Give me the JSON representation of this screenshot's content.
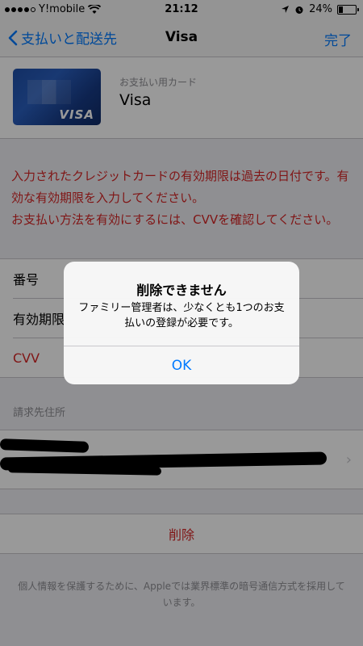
{
  "status_bar": {
    "carrier": "Y!mobile",
    "time": "21:12",
    "battery_percent": "24%",
    "battery_level": 0.24,
    "signal_bars_filled": 4,
    "icons": [
      "wifi-icon",
      "location-icon",
      "alarm-icon",
      "battery-icon"
    ]
  },
  "nav": {
    "back_label": "支払いと配送先",
    "title": "Visa",
    "done_label": "完了"
  },
  "card": {
    "label": "お支払い用カード",
    "name": "Visa",
    "brand": "VISA"
  },
  "error": {
    "line1": "入力されたクレジットカードの有効期限は過去の日付です。有効な有効期限を入力してください。",
    "line2": "お支払い方法を有効にするには、CVVを確認してください。"
  },
  "form": {
    "number_label": "番号",
    "expiry_label": "有効期限",
    "cvv_label": "CVV"
  },
  "billing": {
    "header": "請求先住所"
  },
  "actions": {
    "delete_label": "削除"
  },
  "footer": {
    "text": "個人情報を保護するために、Appleでは業界標準の暗号通信方式を採用しています。"
  },
  "alert": {
    "title": "削除できません",
    "message": "ファミリー管理者は、少なくとも1つのお支払いの登録が必要です。",
    "ok_label": "OK"
  },
  "colors": {
    "accent": "#007aff",
    "error": "#d62525",
    "background": "#efeff4"
  }
}
